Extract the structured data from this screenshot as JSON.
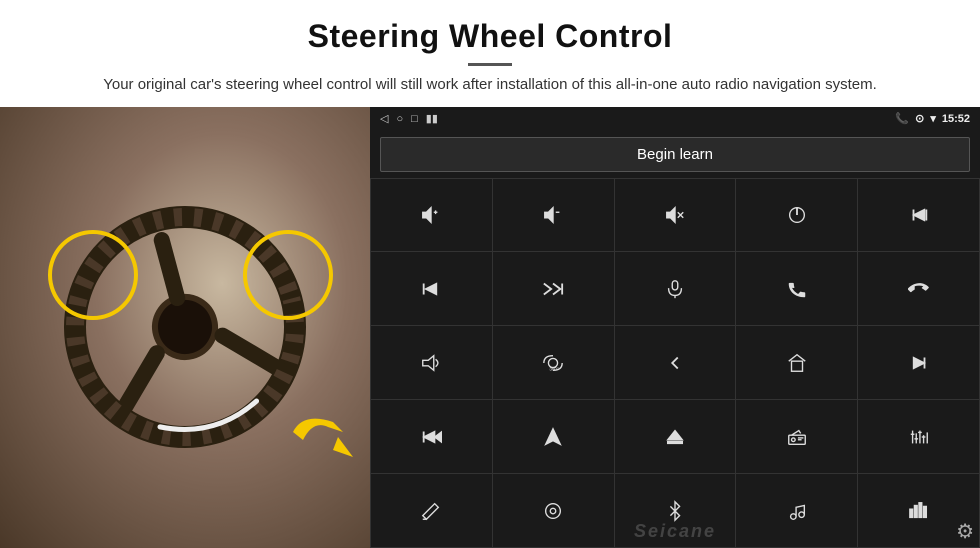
{
  "header": {
    "title": "Steering Wheel Control",
    "subtitle": "Your original car's steering wheel control will still work after installation of this all-in-one auto radio navigation system."
  },
  "radio": {
    "status_bar": {
      "back_icon": "◁",
      "home_icon": "○",
      "square_icon": "□",
      "signal_icon": "▪▪",
      "phone_icon": "📞",
      "location_icon": "⊕",
      "wifi_icon": "▾",
      "time": "15:52"
    },
    "begin_learn_label": "Begin learn",
    "grid_icons": [
      {
        "id": "vol-up",
        "symbol": "vol+"
      },
      {
        "id": "vol-down",
        "symbol": "vol-"
      },
      {
        "id": "mute",
        "symbol": "mute"
      },
      {
        "id": "power",
        "symbol": "pwr"
      },
      {
        "id": "prev-track-phone",
        "symbol": "prev+phone"
      },
      {
        "id": "next-track",
        "symbol": "next"
      },
      {
        "id": "seek-fwd",
        "symbol": "seek"
      },
      {
        "id": "mic",
        "symbol": "mic"
      },
      {
        "id": "call",
        "symbol": "call"
      },
      {
        "id": "hang-up",
        "symbol": "hangup"
      },
      {
        "id": "horn",
        "symbol": "horn"
      },
      {
        "id": "cam360",
        "symbol": "360"
      },
      {
        "id": "back",
        "symbol": "back"
      },
      {
        "id": "home",
        "symbol": "home"
      },
      {
        "id": "prev-chapter",
        "symbol": "prevchap"
      },
      {
        "id": "fast-fwd",
        "symbol": "ffwd"
      },
      {
        "id": "nav",
        "symbol": "nav"
      },
      {
        "id": "eject",
        "symbol": "eject"
      },
      {
        "id": "radio",
        "symbol": "radio"
      },
      {
        "id": "eq",
        "symbol": "eq"
      },
      {
        "id": "pen",
        "symbol": "pen"
      },
      {
        "id": "menu",
        "symbol": "menu"
      },
      {
        "id": "bluetooth",
        "symbol": "bt"
      },
      {
        "id": "music",
        "symbol": "music"
      },
      {
        "id": "equalizer",
        "symbol": "eqlz"
      }
    ],
    "watermark": "Seicane",
    "settings_icon": "⚙"
  }
}
